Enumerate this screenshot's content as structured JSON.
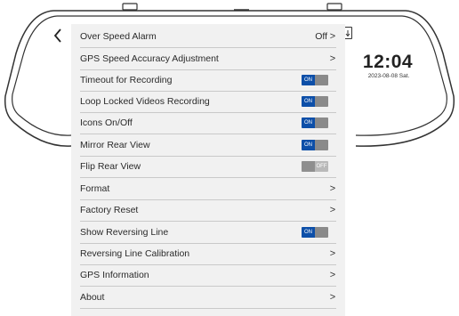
{
  "clock": {
    "time": "12:04",
    "date": "2023-08-08 Sat."
  },
  "menu": [
    {
      "label": "Over Speed Alarm",
      "kind": "value",
      "value": "Off",
      "chevron": ">"
    },
    {
      "label": "GPS Speed Accuracy Adjustment",
      "kind": "link",
      "chevron": ">"
    },
    {
      "label": "Timeout for Recording",
      "kind": "toggle",
      "state": "ON",
      "on": true
    },
    {
      "label": "Loop Locked Videos Recording",
      "kind": "toggle",
      "state": "ON",
      "on": true
    },
    {
      "label": "Icons On/Off",
      "kind": "toggle",
      "state": "ON",
      "on": true
    },
    {
      "label": "Mirror Rear View",
      "kind": "toggle",
      "state": "ON",
      "on": true
    },
    {
      "label": "Flip Rear View",
      "kind": "toggle",
      "state": "OFF",
      "on": false
    },
    {
      "label": "Format",
      "kind": "link",
      "chevron": ">"
    },
    {
      "label": "Factory Reset",
      "kind": "link",
      "chevron": ">"
    },
    {
      "label": "Show Reversing Line",
      "kind": "toggle",
      "state": "ON",
      "on": true
    },
    {
      "label": "Reversing Line Calibration",
      "kind": "link",
      "chevron": ">"
    },
    {
      "label": "GPS Information",
      "kind": "link",
      "chevron": ">"
    },
    {
      "label": "About",
      "kind": "link",
      "chevron": ">"
    }
  ],
  "colors": {
    "toggle_on": "#0d4fa8",
    "panel": "#f1f1f1",
    "divider": "#c9c9c9"
  },
  "icons": {
    "back": "chevron-left-icon",
    "status": "download-icon"
  }
}
